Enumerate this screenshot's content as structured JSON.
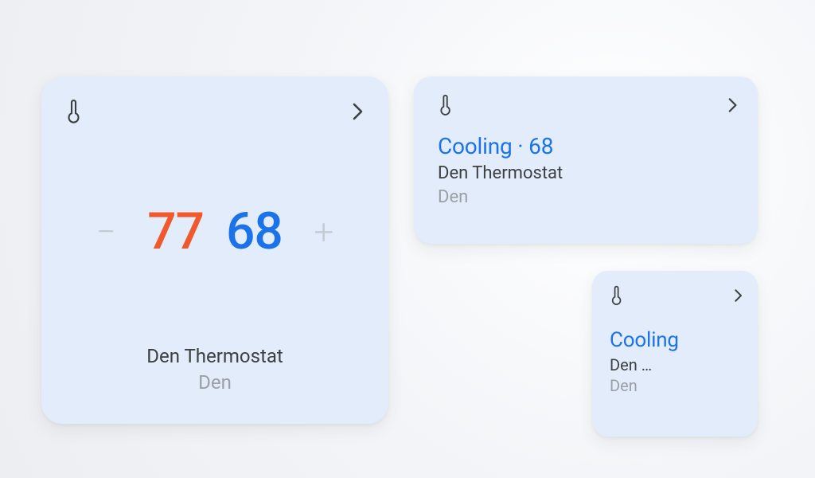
{
  "large_card": {
    "heat_setpoint": "77",
    "cool_setpoint": "68",
    "minus": "−",
    "plus": "+",
    "device": "Den Thermostat",
    "room": "Den"
  },
  "medium_card": {
    "status": "Cooling · 68",
    "device": "Den Thermostat",
    "room": "Den"
  },
  "small_card": {
    "status": "Cooling",
    "device": "Den …",
    "room": "Den"
  }
}
